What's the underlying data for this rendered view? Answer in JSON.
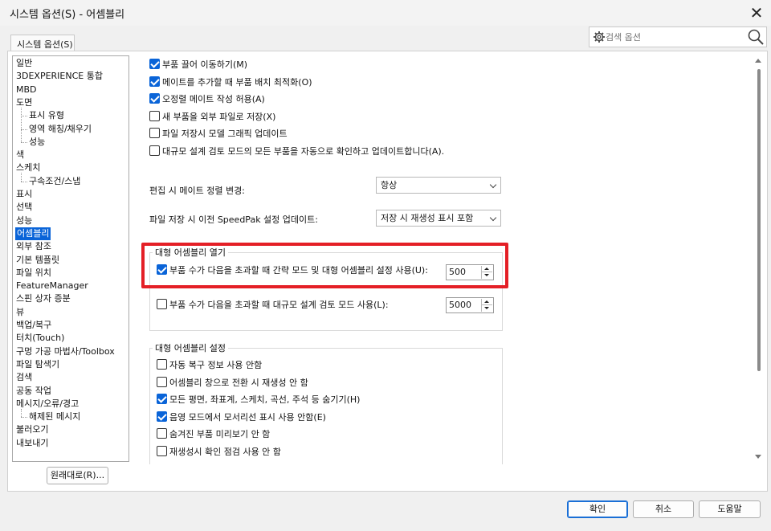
{
  "window": {
    "title": "시스템 옵션(S) - 어셈블리",
    "close_symbol": "✕"
  },
  "tab": {
    "label": "시스템 옵션(S)"
  },
  "search": {
    "placeholder": "검색 옵션"
  },
  "tree": {
    "items": [
      {
        "label": "일반",
        "level": 0
      },
      {
        "label": "3DEXPERIENCE 통합",
        "level": 0
      },
      {
        "label": "MBD",
        "level": 0
      },
      {
        "label": "도면",
        "level": 0
      },
      {
        "label": "표시 유형",
        "level": 1
      },
      {
        "label": "영역 해칭/채우기",
        "level": 1
      },
      {
        "label": "성능",
        "level": 1
      },
      {
        "label": "색",
        "level": 0
      },
      {
        "label": "스케치",
        "level": 0
      },
      {
        "label": "구속조건/스냅",
        "level": 1
      },
      {
        "label": "표시",
        "level": 0
      },
      {
        "label": "선택",
        "level": 0
      },
      {
        "label": "성능",
        "level": 0
      },
      {
        "label": "어셈블리",
        "level": 0,
        "selected": true
      },
      {
        "label": "외부 참조",
        "level": 0
      },
      {
        "label": "기본 템플릿",
        "level": 0
      },
      {
        "label": "파일 위치",
        "level": 0
      },
      {
        "label": "FeatureManager",
        "level": 0
      },
      {
        "label": "스핀 상자 증분",
        "level": 0
      },
      {
        "label": "뷰",
        "level": 0
      },
      {
        "label": "백업/복구",
        "level": 0
      },
      {
        "label": "터치(Touch)",
        "level": 0
      },
      {
        "label": "구멍 가공 마법사/Toolbox",
        "level": 0
      },
      {
        "label": "파일 탐색기",
        "level": 0
      },
      {
        "label": "검색",
        "level": 0
      },
      {
        "label": "공동 작업",
        "level": 0
      },
      {
        "label": "메시지/오류/경고",
        "level": 0
      },
      {
        "label": "해제된 메시지",
        "level": 1
      },
      {
        "label": "불러오기",
        "level": 0
      },
      {
        "label": "내보내기",
        "level": 0
      }
    ]
  },
  "reset_button": {
    "label": "원래대로(R)..."
  },
  "options": {
    "top_checkboxes": [
      {
        "label": "부품 끌어 이동하기(M)",
        "checked": true
      },
      {
        "label": "메이트를 추가할 때 부품 배치 최적화(O)",
        "checked": true
      },
      {
        "label": "오정렬 메이트 작성 허용(A)",
        "checked": true
      },
      {
        "label": "새 부품을 외부 파일로 저장(X)",
        "checked": false
      },
      {
        "label": "파일 저장시 모델 그래픽 업데이트",
        "checked": false
      },
      {
        "label": "대규모 설계 검토 모드의 모든 부품을 자동으로 확인하고 업데이트합니다(A).",
        "checked": false
      }
    ],
    "mate_align": {
      "label": "편집 시 메이트 정렬 변경:",
      "value": "항상"
    },
    "speedpak": {
      "label": "파일 저장 시 이전 SpeedPak 설정 업데이트:",
      "value": "저장 시 재생성 표시 포함"
    },
    "open_large": {
      "title": "대형 어셈블리 열기",
      "lightweight": {
        "label": "부품 수가 다음을 초과할 때 간략 모드 및 대형 어셈블리 설정 사용(U):",
        "checked": true,
        "value": "500"
      },
      "ldr": {
        "label": "부품 수가 다음을 초과할 때 대규모 설계 검토 모드 사용(L):",
        "checked": false,
        "value": "5000"
      }
    },
    "large_settings": {
      "title": "대형 어셈블리 설정",
      "items": [
        {
          "label": "자동 복구 정보 사용 안함",
          "checked": false
        },
        {
          "label": "어셈블리 창으로 전환 시 재생성 안 함",
          "checked": false
        },
        {
          "label": "모든 평면, 좌표계, 스케치, 곡선, 주석 등 숨기기(H)",
          "checked": true
        },
        {
          "label": "음영 모드에서 모서리선 표시 사용 안함(E)",
          "checked": true
        },
        {
          "label": "숨겨진 부품 미리보기 안 함",
          "checked": false
        },
        {
          "label": "재생성시 확인 점검 사용 안 함",
          "checked": false
        }
      ]
    }
  },
  "footer": {
    "ok": "확인",
    "cancel": "취소",
    "help": "도움말"
  },
  "colors": {
    "accent": "#0a64d8",
    "highlight_box": "#e41f26"
  }
}
